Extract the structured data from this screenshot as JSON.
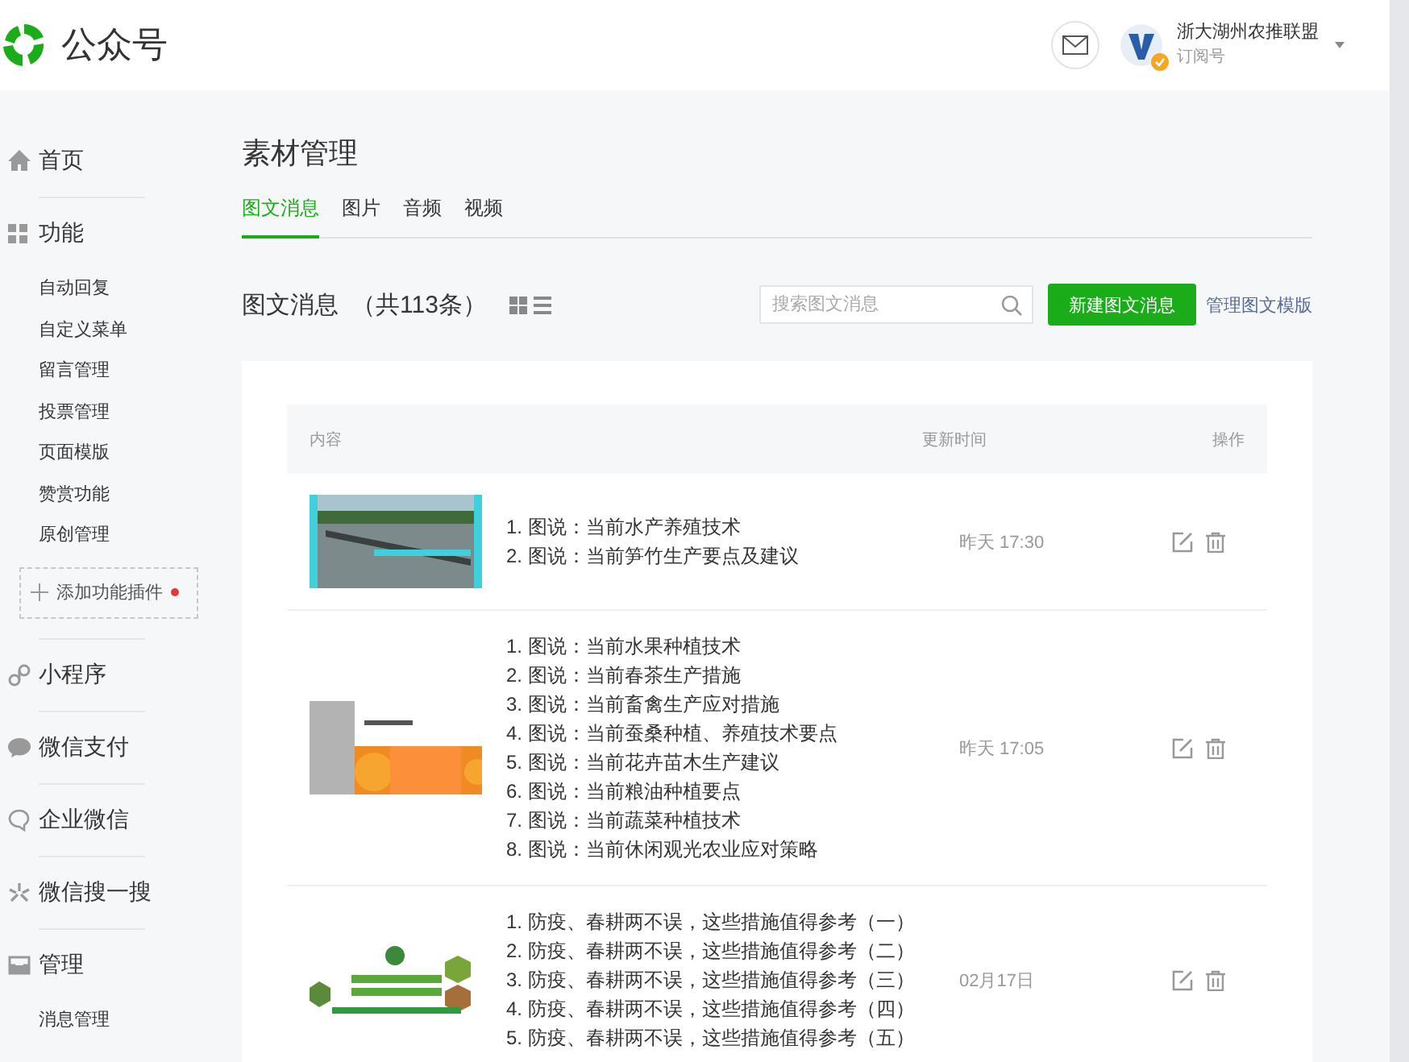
{
  "header": {
    "brand": "公众号",
    "account": {
      "name": "浙大湖州农推联盟",
      "type": "订阅号",
      "verified": true
    }
  },
  "sidebar": [
    {
      "label": "首页"
    },
    {
      "label": "功能",
      "children": [
        {
          "label": "自动回复"
        },
        {
          "label": "自定义菜单"
        },
        {
          "label": "留言管理"
        },
        {
          "label": "投票管理"
        },
        {
          "label": "页面模版"
        },
        {
          "label": "赞赏功能"
        },
        {
          "label": "原创管理"
        }
      ],
      "add_plugin": {
        "label": "添加功能插件",
        "dot": true
      }
    },
    {
      "label": "小程序"
    },
    {
      "label": "微信支付"
    },
    {
      "label": "企业微信"
    },
    {
      "label": "微信搜一搜"
    },
    {
      "label": "管理",
      "children": [
        {
          "label": "消息管理"
        }
      ]
    }
  ],
  "page_title": "素材管理",
  "tabs": [
    {
      "label": "图文消息",
      "selected": true
    },
    {
      "label": "图片",
      "selected": false
    },
    {
      "label": "音频",
      "selected": false
    },
    {
      "label": "视频",
      "selected": false
    }
  ],
  "list_title": "图文消息",
  "list_count": "（共113条）",
  "search": {
    "placeholder": "搜索图文消息"
  },
  "new_button": "新建图文消息",
  "template_link": "管理图文模版",
  "table": {
    "columns": [
      "内容",
      "更新时间",
      "操作"
    ],
    "rows": [
      {
        "titles": [
          "1. 图说：当前水产养殖技术",
          "2. 图说：当前笋竹生产要点及建议"
        ],
        "time": "昨天 17:30"
      },
      {
        "titles": [
          "1. 图说：当前水果种植技术",
          "2. 图说：当前春茶生产措施",
          "3. 图说：当前畜禽生产应对措施",
          "4. 图说：当前蚕桑种植、养殖技术要点",
          "5. 图说：当前花卉苗木生产建议",
          "6. 图说：当前粮油种植要点",
          "7. 图说：当前蔬菜种植技术",
          "8. 图说：当前休闲观光农业应对策略"
        ],
        "time": "昨天 17:05"
      },
      {
        "titles": [
          "1. 防疫、春耕两不误，这些措施值得参考（一）",
          "2. 防疫、春耕两不误，这些措施值得参考（二）",
          "3. 防疫、春耕两不误，这些措施值得参考（三）",
          "4. 防疫、春耕两不误，这些措施值得参考（四）",
          "5. 防疫、春耕两不误，这些措施值得参考（五）"
        ],
        "time": "02月17日"
      }
    ]
  }
}
